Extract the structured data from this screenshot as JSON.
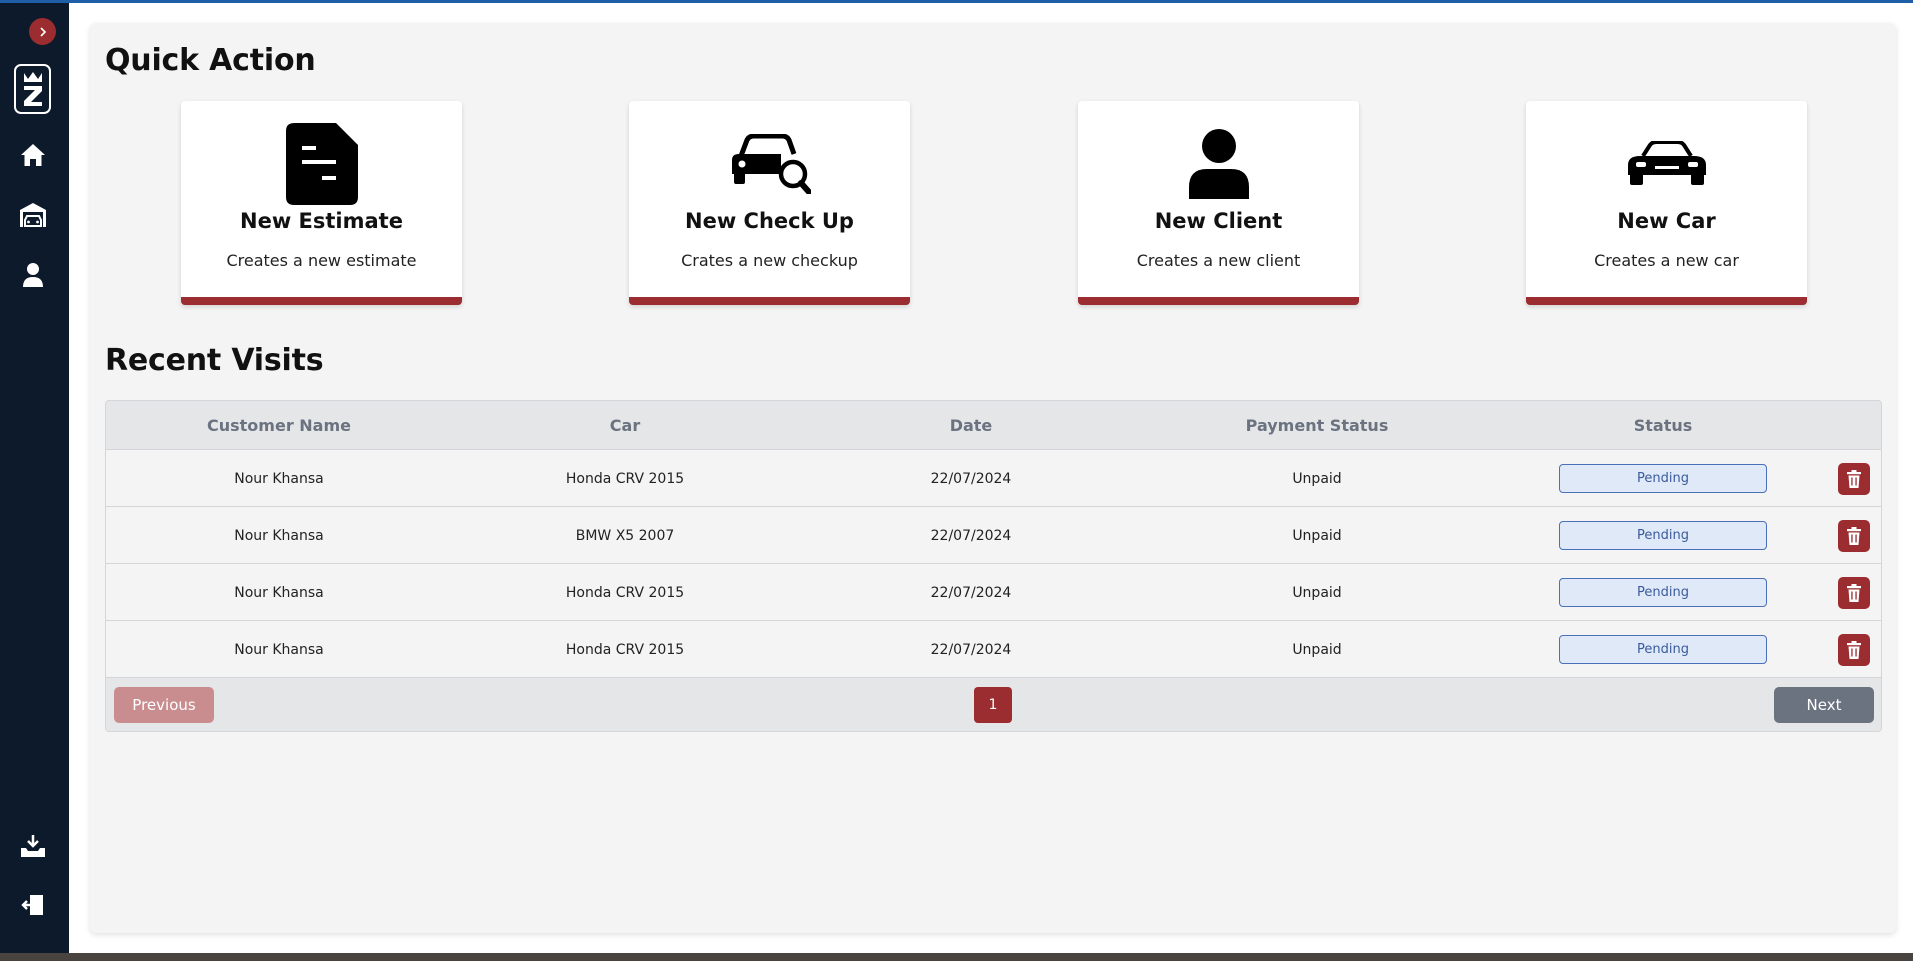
{
  "sidebar": {
    "icons": [
      "chevron-right-icon",
      "logo-z-icon",
      "home-icon",
      "garage-icon",
      "user-icon",
      "download-icon",
      "logout-icon"
    ]
  },
  "quick_action": {
    "title": "Quick Action",
    "cards": [
      {
        "title": "New Estimate",
        "desc": "Creates a new estimate",
        "icon": "document-icon"
      },
      {
        "title": "New Check Up",
        "desc": "Crates a new checkup",
        "icon": "car-search-icon"
      },
      {
        "title": "New Client",
        "desc": "Creates a new client",
        "icon": "user-icon"
      },
      {
        "title": "New Car",
        "desc": "Creates a new car",
        "icon": "car-icon"
      }
    ]
  },
  "recent_visits": {
    "title": "Recent Visits",
    "columns": [
      "Customer Name",
      "Car",
      "Date",
      "Payment Status",
      "Status"
    ],
    "rows": [
      {
        "customer": "Nour Khansa",
        "car": "Honda CRV 2015",
        "date": "22/07/2024",
        "payment": "Unpaid",
        "status": "Pending"
      },
      {
        "customer": "Nour Khansa",
        "car": "BMW X5 2007",
        "date": "22/07/2024",
        "payment": "Unpaid",
        "status": "Pending"
      },
      {
        "customer": "Nour Khansa",
        "car": "Honda CRV 2015",
        "date": "22/07/2024",
        "payment": "Unpaid",
        "status": "Pending"
      },
      {
        "customer": "Nour Khansa",
        "car": "Honda CRV 2015",
        "date": "22/07/2024",
        "payment": "Unpaid",
        "status": "Pending"
      }
    ],
    "pagination": {
      "previous": "Previous",
      "page": "1",
      "next": "Next"
    }
  },
  "colors": {
    "sidebar": "#0c1a2c",
    "accent": "#9b2c2f",
    "badge_border": "#4a70b8",
    "badge_bg": "#dfe9f8"
  }
}
